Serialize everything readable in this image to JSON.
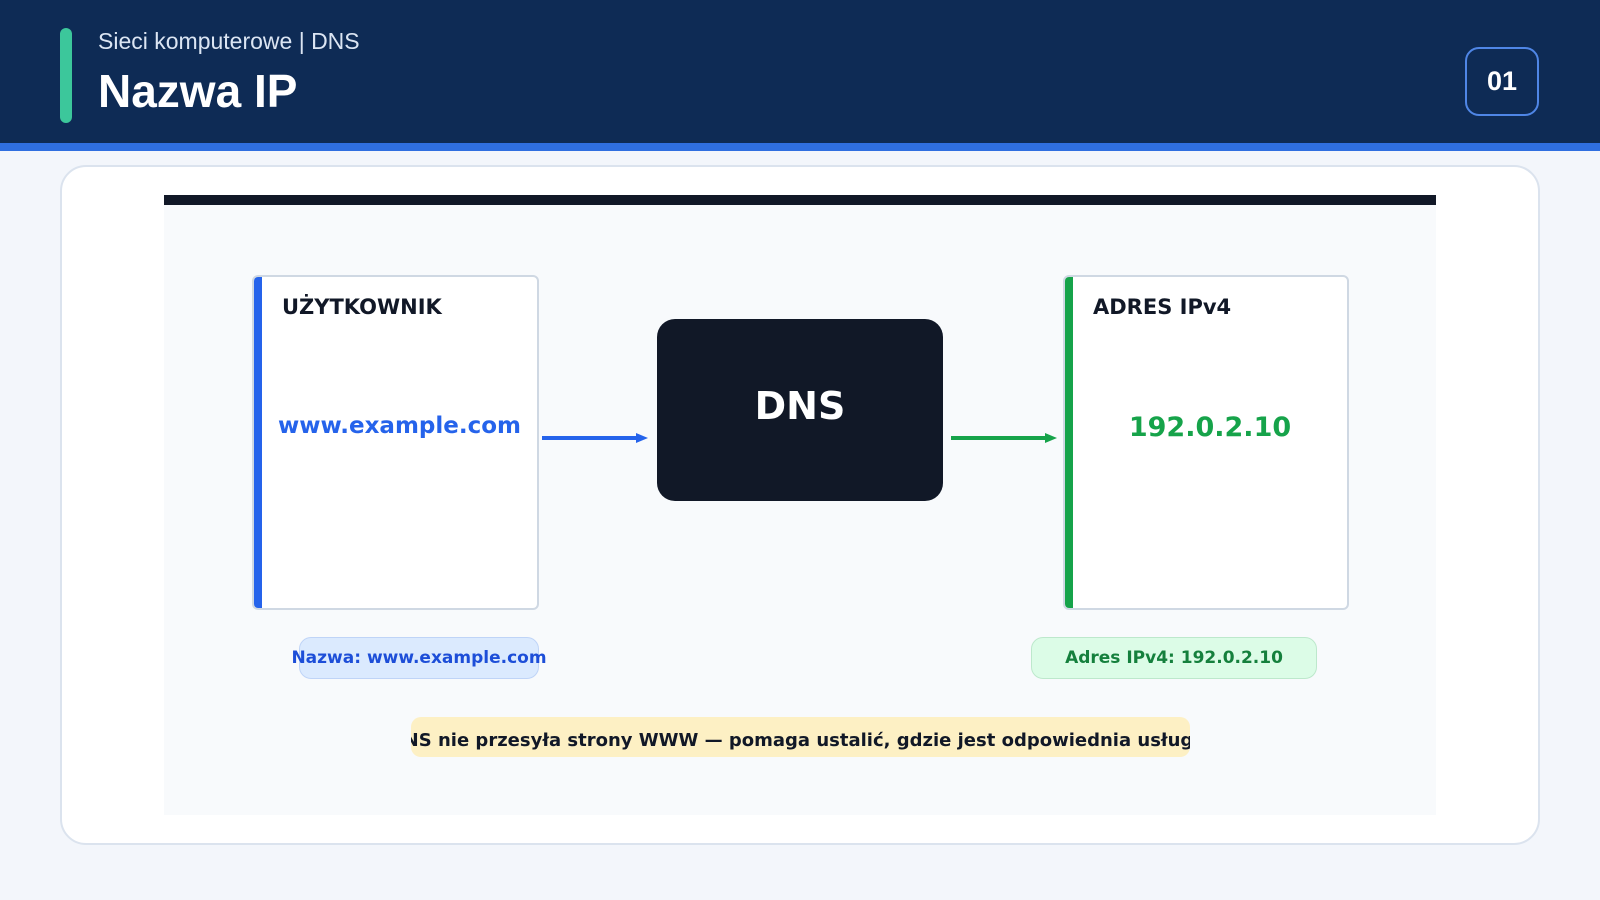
{
  "header": {
    "subtitle": "Sieci komputerowe | DNS",
    "title": "Nazwa IP",
    "page_number": "01"
  },
  "diagram": {
    "user_box": {
      "label": "UŻYTKOWNIK",
      "value": "www.example.com"
    },
    "dns_box": {
      "label": "DNS"
    },
    "ip_box": {
      "label": "ADRES IPv4",
      "value": "192.0.2.10"
    },
    "name_pill": "Nazwa: www.example.com",
    "ip_pill": "Adres IPv4: 192.0.2.10",
    "note": "DNS nie przesyła strony WWW — pomaga ustalić, gdzie jest odpowiednia usługa."
  },
  "colors": {
    "header_bg": "#0e2b55",
    "accent": "#3cc79b",
    "blue": "#2563eb",
    "green": "#16a34a",
    "dark": "#111827",
    "note_bg": "#fdf0c4"
  },
  "icons": {
    "arrow_user_to_dns": "arrow-right-icon",
    "arrow_dns_to_ip": "arrow-right-icon"
  }
}
